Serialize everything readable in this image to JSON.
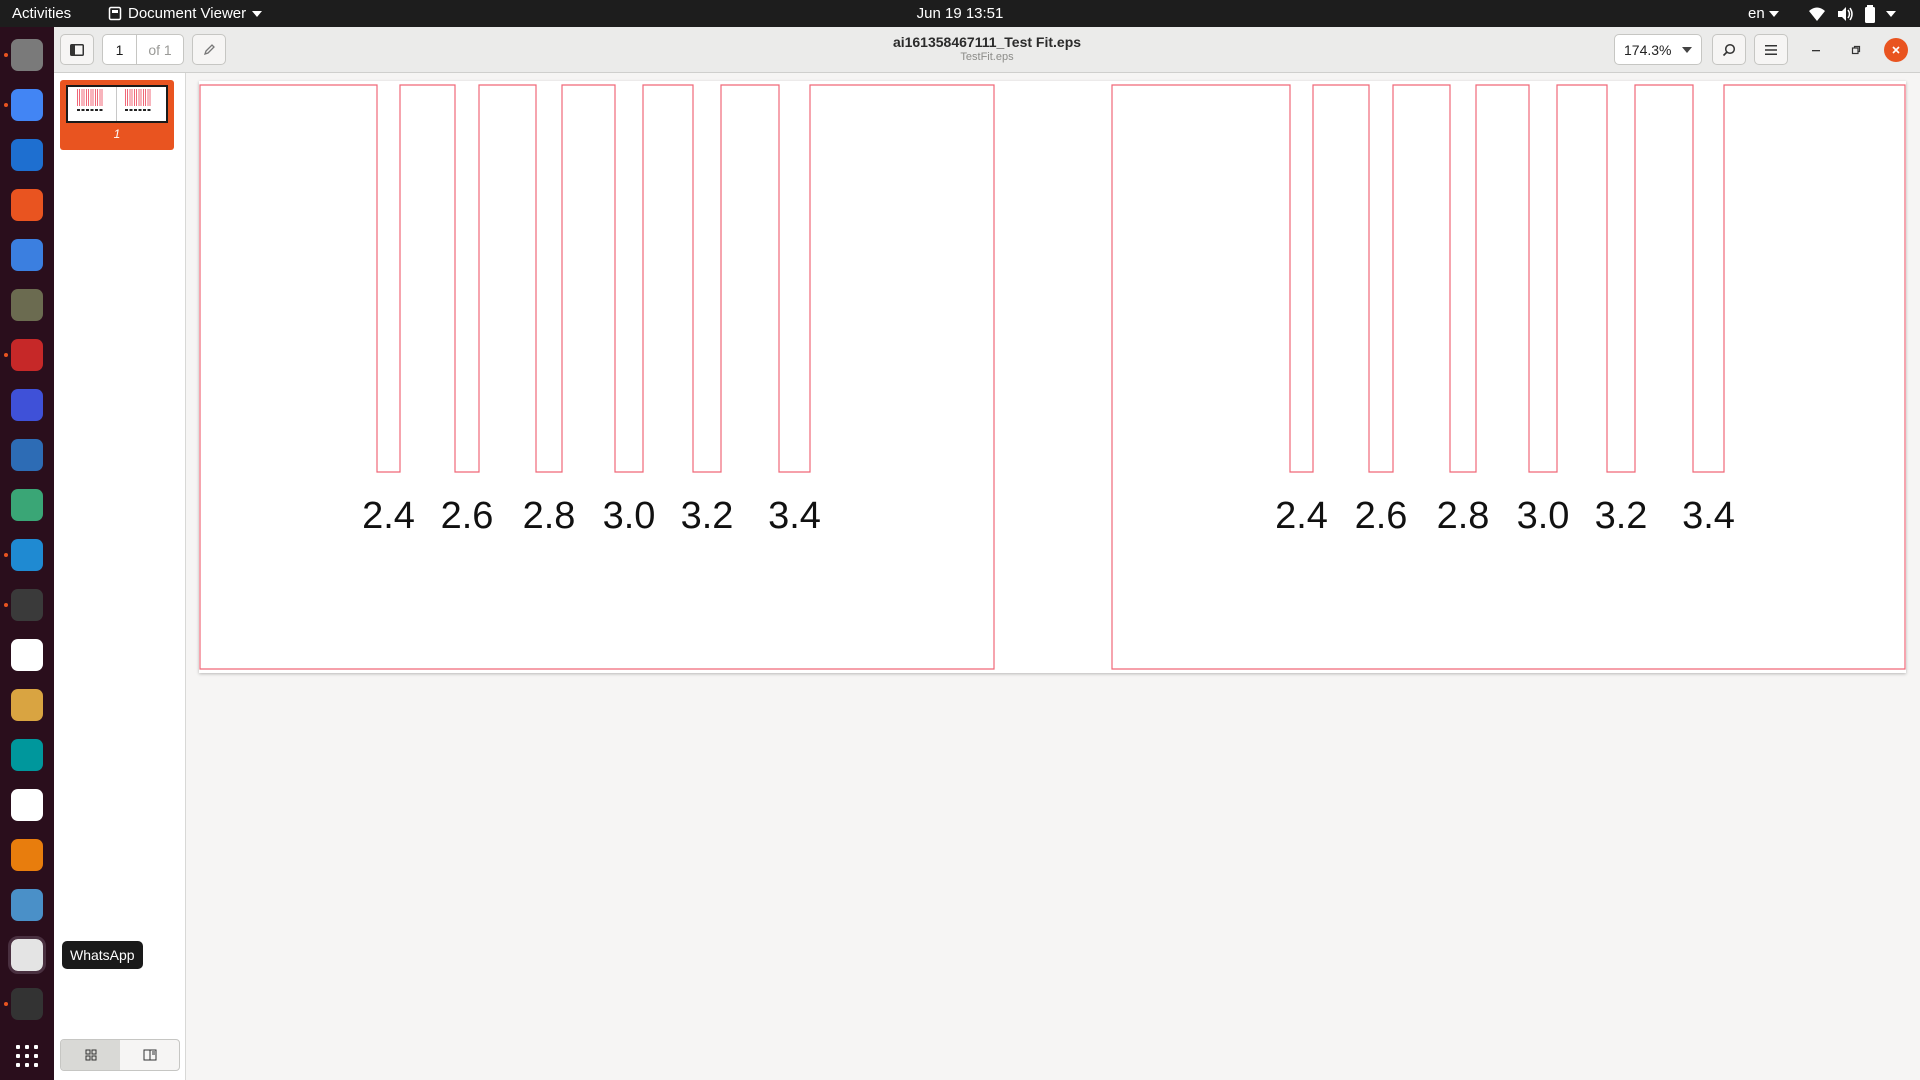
{
  "topbar": {
    "activities": "Activities",
    "app_name": "Document Viewer",
    "clock": "Jun 19  13:51",
    "language": "en"
  },
  "dock": {
    "apps": [
      {
        "name": "files-icon",
        "color": "#7a7a7a",
        "running": true
      },
      {
        "name": "chrome-icon",
        "color": "#4285f4",
        "running": true
      },
      {
        "name": "writer-icon",
        "color": "#1e6fd0",
        "running": false
      },
      {
        "name": "software-center-icon",
        "color": "#e95420",
        "running": false
      },
      {
        "name": "help-icon",
        "color": "#3b7fe0",
        "running": false
      },
      {
        "name": "gimp-icon",
        "color": "#6b6b50",
        "running": false
      },
      {
        "name": "filezilla-icon",
        "color": "#c62828",
        "running": true
      },
      {
        "name": "screenshot-icon",
        "color": "#3f51d8",
        "running": false
      },
      {
        "name": "remote-desktop-icon",
        "color": "#2d6cb5",
        "running": false
      },
      {
        "name": "atom-icon",
        "color": "#3aa676",
        "running": false
      },
      {
        "name": "vscode-icon",
        "color": "#1f8ad2",
        "running": true
      },
      {
        "name": "inkscape-icon",
        "color": "#3a3a3a",
        "running": true
      },
      {
        "name": "text-editor-icon",
        "color": "#ffffff",
        "running": false
      },
      {
        "name": "image-viewer-icon",
        "color": "#d9a441",
        "running": false
      },
      {
        "name": "arduino-icon",
        "color": "#00979c",
        "running": false
      },
      {
        "name": "slack-icon",
        "color": "#ffffff",
        "running": false
      },
      {
        "name": "blender-icon",
        "color": "#e87d0d",
        "running": false
      },
      {
        "name": "browser-icon",
        "color": "#4a90c8",
        "running": false
      },
      {
        "name": "whatsapp-icon",
        "color": "#e4e4e4",
        "running": false
      },
      {
        "name": "terminal-icon",
        "color": "#333333",
        "running": true
      }
    ],
    "tooltip": "WhatsApp"
  },
  "headerbar": {
    "page_current": "1",
    "page_total": "of 1",
    "title": "ai161358467111_Test Fit.eps",
    "subtitle": "TestFit.eps",
    "zoom": "174.3%"
  },
  "sidebar": {
    "thumbnail_label": "1"
  },
  "document": {
    "line_color": "#f06878",
    "panels": [
      {
        "labels": [
          "2.4",
          "2.6",
          "2.8",
          "3.0",
          "3.2",
          "3.4"
        ]
      },
      {
        "labels": [
          "2.4",
          "2.6",
          "2.8",
          "3.0",
          "3.2",
          "3.4"
        ]
      }
    ]
  }
}
